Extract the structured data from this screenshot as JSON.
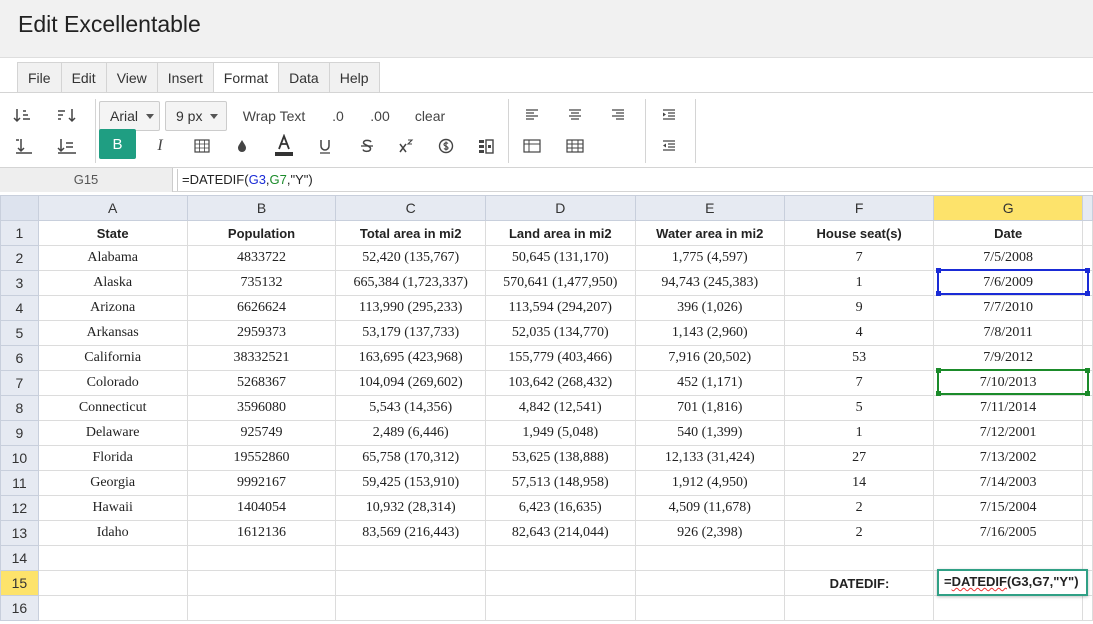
{
  "app": {
    "title": "Edit Excellentable"
  },
  "menu": [
    "File",
    "Edit",
    "View",
    "Insert",
    "Format",
    "Data",
    "Help"
  ],
  "menu_active": "Format",
  "toolbar": {
    "font_family": "Arial",
    "font_size": "9 px",
    "wrap_text": "Wrap Text",
    "decimal_decrease": ".0",
    "decimal_increase": ".00",
    "clear": "clear",
    "bold": "B",
    "italic": "I"
  },
  "formula_bar": {
    "cell_ref": "G15",
    "formula_prefix": "=DATEDIF(",
    "ref_a": "G3",
    "sep1": ",",
    "ref_b": "G7",
    "formula_suffix": ",\"Y\")"
  },
  "columns": [
    "A",
    "B",
    "C",
    "D",
    "E",
    "F",
    "G"
  ],
  "selected_column": "G",
  "selected_row": 15,
  "rows": [
    [
      "State",
      "Population",
      "Total area in mi2",
      "Land area in mi2",
      "Water area in mi2",
      "House seat(s)",
      "Date"
    ],
    [
      "Alabama",
      "4833722",
      "52,420 (135,767)",
      "50,645 (131,170)",
      "1,775 (4,597)",
      "7",
      "7/5/2008"
    ],
    [
      "Alaska",
      "735132",
      "665,384 (1,723,337)",
      "570,641 (1,477,950)",
      "94,743 (245,383)",
      "1",
      "7/6/2009"
    ],
    [
      "Arizona",
      "6626624",
      "113,990 (295,233)",
      "113,594 (294,207)",
      "396 (1,026)",
      "9",
      "7/7/2010"
    ],
    [
      "Arkansas",
      "2959373",
      "53,179 (137,733)",
      "52,035 (134,770)",
      "1,143 (2,960)",
      "4",
      "7/8/2011"
    ],
    [
      "California",
      "38332521",
      "163,695 (423,968)",
      "155,779 (403,466)",
      "7,916 (20,502)",
      "53",
      "7/9/2012"
    ],
    [
      "Colorado",
      "5268367",
      "104,094 (269,602)",
      "103,642 (268,432)",
      "452 (1,171)",
      "7",
      "7/10/2013"
    ],
    [
      "Connecticut",
      "3596080",
      "5,543 (14,356)",
      "4,842 (12,541)",
      "701 (1,816)",
      "5",
      "7/11/2014"
    ],
    [
      "Delaware",
      "925749",
      "2,489 (6,446)",
      "1,949 (5,048)",
      "540 (1,399)",
      "1",
      "7/12/2001"
    ],
    [
      "Florida",
      "19552860",
      "65,758 (170,312)",
      "53,625 (138,888)",
      "12,133 (31,424)",
      "27",
      "7/13/2002"
    ],
    [
      "Georgia",
      "9992167",
      "59,425 (153,910)",
      "57,513 (148,958)",
      "1,912 (4,950)",
      "14",
      "7/14/2003"
    ],
    [
      "Hawaii",
      "1404054",
      "10,932 (28,314)",
      "6,423 (16,635)",
      "4,509 (11,678)",
      "2",
      "7/15/2004"
    ],
    [
      "Idaho",
      "1612136",
      "83,569 (216,443)",
      "82,643 (214,044)",
      "926 (2,398)",
      "2",
      "7/16/2005"
    ],
    [
      "",
      "",
      "",
      "",
      "",
      "",
      ""
    ],
    [
      "",
      "",
      "",
      "",
      "",
      "DATEDIF:",
      ""
    ],
    [
      "",
      "",
      "",
      "",
      "",
      "",
      ""
    ]
  ],
  "editor": {
    "value_prefix": "=",
    "value_squiggle": "DATEDIF",
    "value_suffix": "(G3,G7,\"Y\")"
  }
}
